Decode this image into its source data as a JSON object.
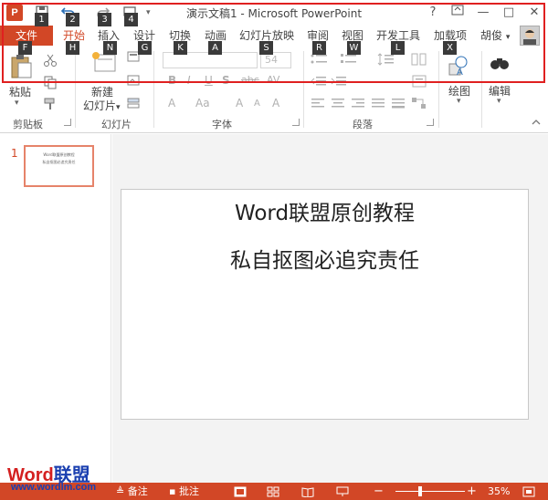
{
  "window": {
    "title": "演示文稿1 - Microsoft PowerPoint",
    "app_logo": "P",
    "controls": {
      "help": "?",
      "ribbon_display": "restore-icon",
      "minimize": "—",
      "maximize": "□",
      "close": "✕"
    }
  },
  "qat_keytips": [
    "1",
    "2",
    "3",
    "4"
  ],
  "tabs": [
    {
      "label": "文件",
      "keytip": "F"
    },
    {
      "label": "开始",
      "keytip": "H",
      "active": true
    },
    {
      "label": "插入",
      "keytip": "N"
    },
    {
      "label": "设计",
      "keytip": "G"
    },
    {
      "label": "切换",
      "keytip": "K"
    },
    {
      "label": "动画",
      "keytip": "A"
    },
    {
      "label": "幻灯片放映",
      "keytip": "S"
    },
    {
      "label": "审阅",
      "keytip": "R"
    },
    {
      "label": "视图",
      "keytip": "W"
    },
    {
      "label": "开发工具",
      "keytip": "L"
    },
    {
      "label": "加载项",
      "keytip": "X"
    }
  ],
  "user": {
    "name": "胡俊"
  },
  "ribbon": {
    "clipboard": {
      "paste_label": "粘贴",
      "group_label": "剪贴板"
    },
    "slides": {
      "new_slide_label_1": "新建",
      "new_slide_label_2": "幻灯片",
      "group_label": "幻灯片"
    },
    "font": {
      "font_size": "54",
      "group_label": "字体"
    },
    "paragraph": {
      "group_label": "段落"
    },
    "drawing": {
      "label": "绘图"
    },
    "editing": {
      "label": "编辑"
    }
  },
  "thumbnail": {
    "number": "1",
    "line1": "Word联盟原创教程",
    "line2": "私自抠图必追究责任"
  },
  "slide": {
    "title": "Word联盟原创教程",
    "subtitle": "私自抠图必追究责任"
  },
  "statusbar": {
    "notes_label": "备注",
    "comments_label": "批注",
    "zoom_minus": "−",
    "zoom_plus": "+",
    "zoom_level": "35%",
    "zoom_fraction": 0.35
  },
  "watermark": {
    "logo_word": "Word",
    "logo_cn": "联盟",
    "url": "www.wordlm.com"
  },
  "colors": {
    "accent": "#d24726",
    "highlight_box": "#e02020",
    "keytip_bg": "#3a3a3a"
  }
}
